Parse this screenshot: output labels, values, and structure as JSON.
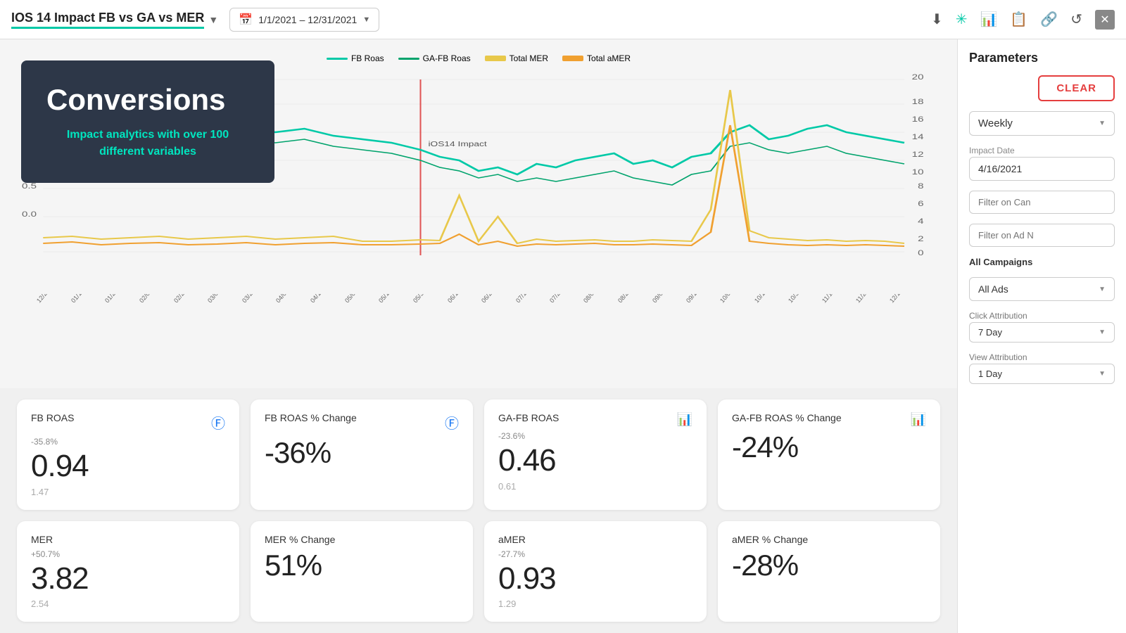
{
  "header": {
    "title": "IOS 14 Impact FB vs GA vs MER",
    "date_range": "1/1/2021 – 12/31/2021",
    "icons": [
      "download",
      "star-plus",
      "bar-chart",
      "clipboard",
      "link",
      "refresh",
      "close"
    ]
  },
  "hero": {
    "heading": "Conversions",
    "subtext": "Impact analytics with over 100 different variables"
  },
  "chart": {
    "legend": [
      {
        "label": "FB Roas",
        "color": "#00c9a7"
      },
      {
        "label": "GA-FB Roas",
        "color": "#00a36c"
      },
      {
        "label": "Total MER",
        "color": "#e8c84a"
      },
      {
        "label": "Total aMER",
        "color": "#f0a030"
      }
    ],
    "ios14_label": "iOS14 Impact"
  },
  "metrics": [
    {
      "title": "FB ROAS",
      "icon": "fb",
      "change": "-35.8%",
      "value": "0.94",
      "sub": "1.47"
    },
    {
      "title": "FB ROAS % Change",
      "icon": "fb",
      "change": "",
      "value": "-36%",
      "sub": ""
    },
    {
      "title": "GA-FB ROAS",
      "icon": "bar",
      "change": "-23.6%",
      "value": "0.46",
      "sub": "0.61"
    },
    {
      "title": "GA-FB ROAS % Change",
      "icon": "bar",
      "change": "",
      "value": "-24%",
      "sub": ""
    },
    {
      "title": "MER",
      "icon": "",
      "change": "+50.7%",
      "value": "3.82",
      "sub": "2.54"
    },
    {
      "title": "MER % Change",
      "icon": "",
      "change": "",
      "value": "51%",
      "sub": ""
    },
    {
      "title": "aMER",
      "icon": "",
      "change": "-27.7%",
      "value": "0.93",
      "sub": "1.29"
    },
    {
      "title": "aMER % Change",
      "icon": "",
      "change": "",
      "value": "-28%",
      "sub": ""
    }
  ],
  "sidebar": {
    "title": "Parameters",
    "clear_label": "CLEAR",
    "frequency_label": "Weekly",
    "impact_date_label": "Impact Date",
    "impact_date_value": "4/16/2021",
    "filter_campaign_placeholder": "Filter on Can",
    "filter_ad_placeholder": "Filter on Ad N",
    "all_campaigns_label": "All Campaigns",
    "all_ads_label": "All Ads",
    "click_attr_label": "Click Attribution",
    "click_attr_value": "7 Day",
    "view_attr_label": "View Attribution",
    "view_attr_value": "1 Day"
  }
}
